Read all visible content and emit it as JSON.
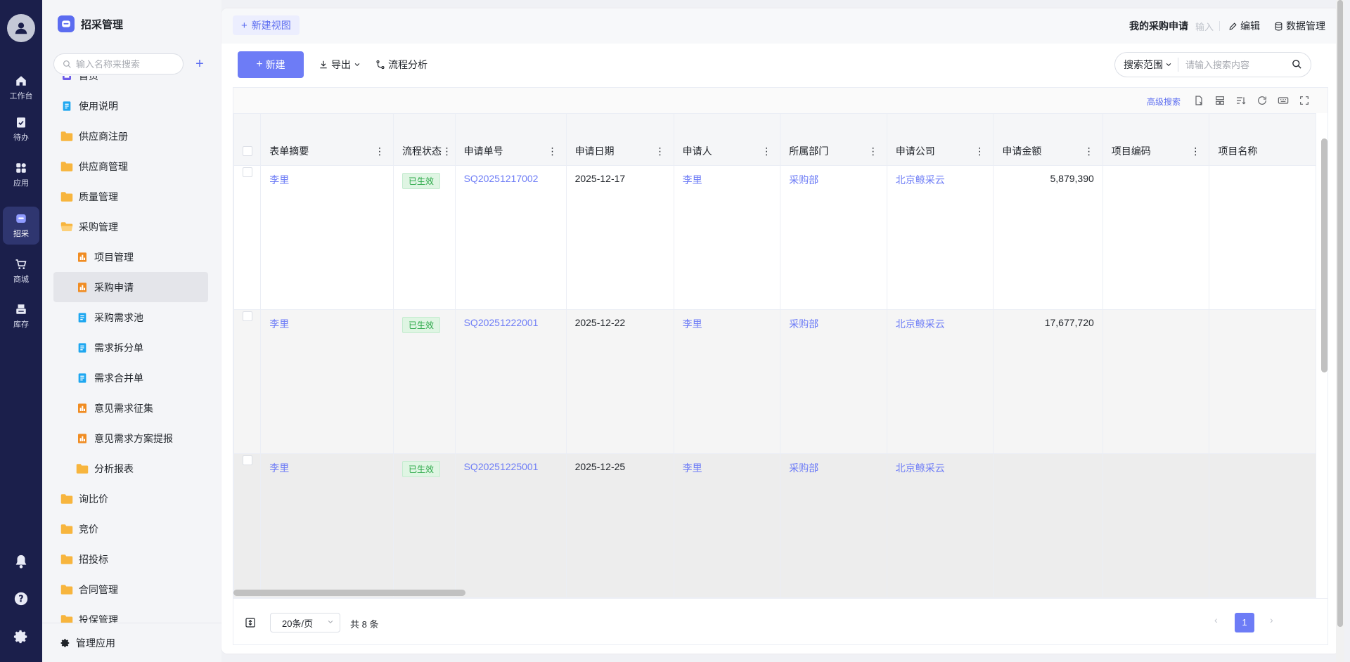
{
  "rail": {
    "items": [
      {
        "label": "工作台",
        "icon": "home-icon"
      },
      {
        "label": "待办",
        "icon": "clipboard-check-icon"
      },
      {
        "label": "应用",
        "icon": "apps-grid-icon"
      },
      {
        "label": "招采",
        "icon": "procurement-app-icon",
        "active": true
      },
      {
        "label": "商城",
        "icon": "cart-icon"
      },
      {
        "label": "库存",
        "icon": "printer-stock-icon"
      }
    ]
  },
  "sidebar": {
    "app_title": "招采管理",
    "search_placeholder": "输入名称来搜索",
    "add_label": "+",
    "items": [
      {
        "label": "首页",
        "level": 1,
        "icon": "home-page-icon"
      },
      {
        "label": "使用说明",
        "level": 1,
        "icon": "doc-icon"
      },
      {
        "label": "供应商注册",
        "level": 1,
        "icon": "folder-icon"
      },
      {
        "label": "供应商管理",
        "level": 1,
        "icon": "folder-icon"
      },
      {
        "label": "质量管理",
        "level": 1,
        "icon": "folder-icon"
      },
      {
        "label": "采购管理",
        "level": 1,
        "icon": "folder-open-icon"
      },
      {
        "label": "项目管理",
        "level": 2,
        "icon": "form-orange-icon"
      },
      {
        "label": "采购申请",
        "level": 2,
        "icon": "form-orange-icon",
        "active": true
      },
      {
        "label": "采购需求池",
        "level": 2,
        "icon": "doc-icon"
      },
      {
        "label": "需求拆分单",
        "level": 2,
        "icon": "doc-icon"
      },
      {
        "label": "需求合并单",
        "level": 2,
        "icon": "doc-icon"
      },
      {
        "label": "意见需求征集",
        "level": 2,
        "icon": "form-orange-icon"
      },
      {
        "label": "意见需求方案提报",
        "level": 2,
        "icon": "form-orange-icon"
      },
      {
        "label": "分析报表",
        "level": 2,
        "icon": "folder-icon"
      },
      {
        "label": "询比价",
        "level": 1,
        "icon": "folder-icon"
      },
      {
        "label": "竞价",
        "level": 1,
        "icon": "folder-icon"
      },
      {
        "label": "招投标",
        "level": 1,
        "icon": "folder-icon"
      },
      {
        "label": "合同管理",
        "level": 1,
        "icon": "folder-icon"
      },
      {
        "label": "投保管理",
        "level": 1,
        "icon": "folder-icon"
      }
    ],
    "footer_label": "管理应用"
  },
  "topbar": {
    "new_view": "新建视图",
    "view_title": "我的采购申请",
    "view_hint": "输入",
    "edit": "编辑",
    "data_manage": "数据管理"
  },
  "toolbar": {
    "new": "新建",
    "export": "导出",
    "flow_analysis": "流程分析",
    "search_scope": "搜索范围",
    "search_placeholder": "请输入搜索内容",
    "advanced_search": "高级搜索"
  },
  "table": {
    "columns": [
      "表单摘要",
      "流程状态",
      "申请单号",
      "申请日期",
      "申请人",
      "所属部门",
      "申请公司",
      "申请金额",
      "项目编码",
      "项目名称"
    ],
    "rows": [
      {
        "summary": "李里",
        "status": "已生效",
        "order_no": "SQ20251217002",
        "date": "2025-12-17",
        "applicant": "李里",
        "dept": "采购部",
        "company": "北京鲸采云",
        "amount": "5,879,390",
        "project_code": "",
        "project_name": ""
      },
      {
        "summary": "李里",
        "status": "已生效",
        "order_no": "SQ20251222001",
        "date": "2025-12-22",
        "applicant": "李里",
        "dept": "采购部",
        "company": "北京鲸采云",
        "amount": "17,677,720",
        "project_code": "",
        "project_name": ""
      },
      {
        "summary": "李里",
        "status": "已生效",
        "order_no": "SQ20251225001",
        "date": "2025-12-25",
        "applicant": "李里",
        "dept": "采购部",
        "company": "北京鲸采云",
        "amount": "",
        "project_code": "",
        "project_name": ""
      }
    ]
  },
  "pager": {
    "page_size": "20条/页",
    "total": "共 8 条",
    "current_page": "1",
    "prev": "‹",
    "next": "›"
  },
  "colors": {
    "rail_bg": "#1b1f4b",
    "accent": "#6d7cf6",
    "success": "#28a745"
  }
}
